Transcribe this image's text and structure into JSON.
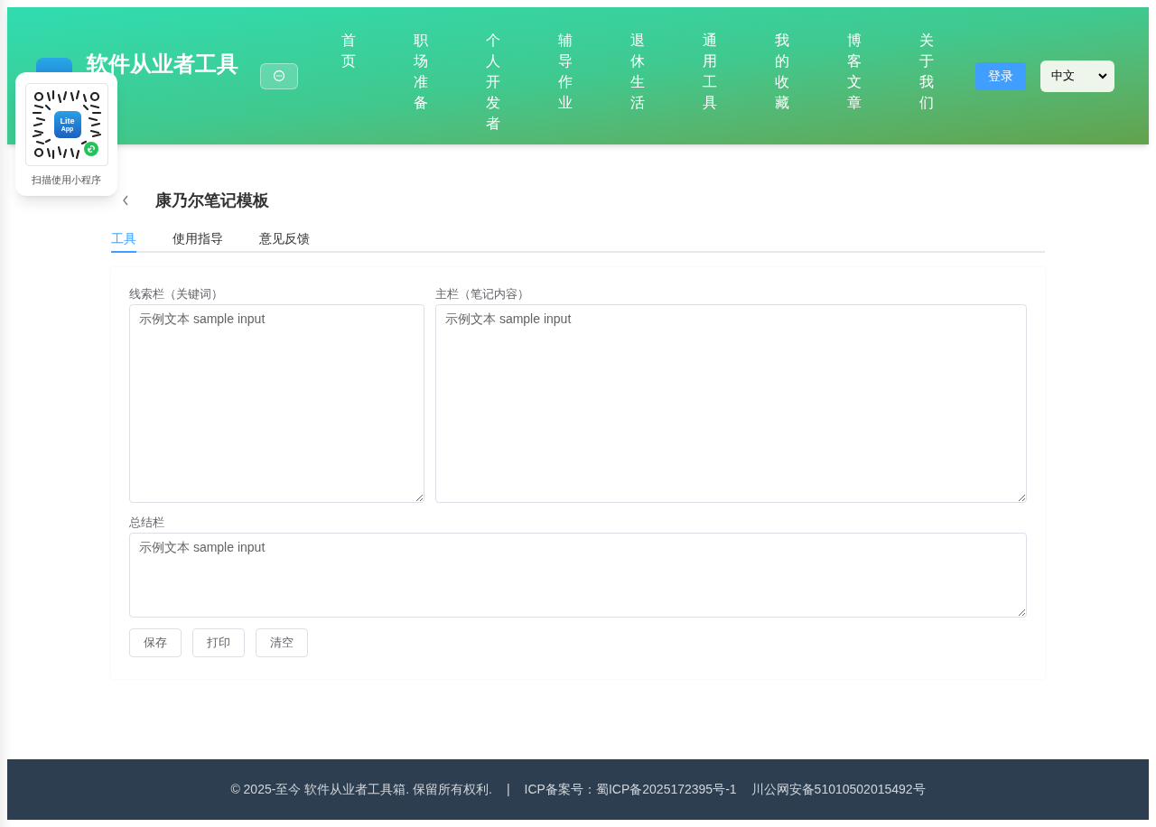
{
  "header": {
    "site_title": "软件从业者工具",
    "nav": [
      {
        "label": "首页"
      },
      {
        "label": "职场准备"
      },
      {
        "label": "个人开发者"
      },
      {
        "label": "辅导作业"
      },
      {
        "label": "退休生活"
      },
      {
        "label": "通用工具"
      },
      {
        "label": "我的收藏"
      },
      {
        "label": "博客文章"
      },
      {
        "label": "关于我们"
      }
    ],
    "login_button": "登录",
    "language_select": "中文"
  },
  "qr_popup": {
    "badge_lines": [
      "Lite",
      "App"
    ],
    "caption": "扫描使用小程序"
  },
  "page": {
    "title": "康乃尔笔记模板",
    "tabs": [
      {
        "label": "工具",
        "selected": true
      },
      {
        "label": "使用指导",
        "selected": false
      },
      {
        "label": "意见反馈",
        "selected": false
      }
    ],
    "fields": [
      {
        "label": "线索栏（关键词）",
        "value": "示例文本 sample input"
      },
      {
        "label": "主栏（笔记内容）",
        "value": "示例文本 sample input"
      },
      {
        "label": "总结栏",
        "value": "示例文本 sample input"
      }
    ],
    "buttons": [
      "保存",
      "打印",
      "清空"
    ]
  },
  "footer": {
    "copyright": "© 2025-至今 软件从业者工具箱. 保留所有权利.",
    "separator": "|",
    "icp": "ICP备案号：蜀ICP备2025172395号-1",
    "police": "川公网安备51010502015492号"
  }
}
